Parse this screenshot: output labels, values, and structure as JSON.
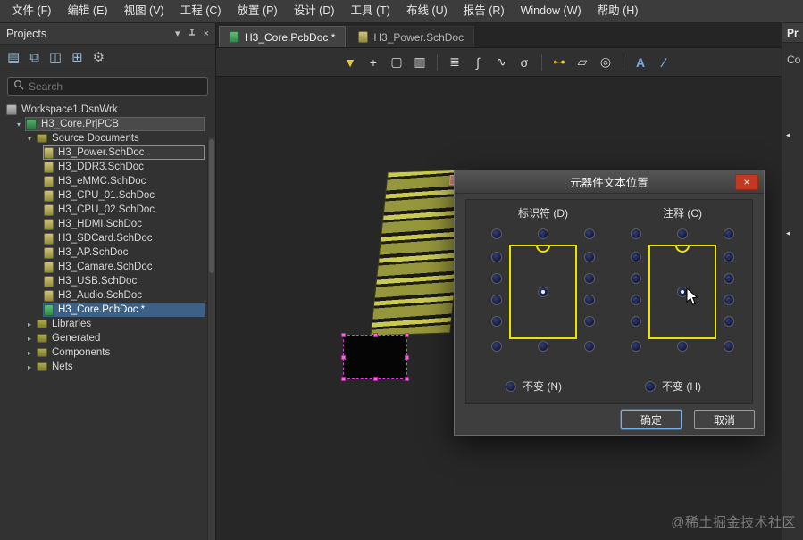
{
  "menu": {
    "items": [
      "文件 (F)",
      "编辑 (E)",
      "视图 (V)",
      "工程 (C)",
      "放置 (P)",
      "设计 (D)",
      "工具 (T)",
      "布线 (U)",
      "报告 (R)",
      "Window (W)",
      "帮助 (H)"
    ]
  },
  "glyphs": {
    "expanded": "▾",
    "collapsed": "▸",
    "dropdown": "▾",
    "close": "×"
  },
  "projects": {
    "title": "Projects",
    "search_placeholder": "Search",
    "toolbar": [
      {
        "name": "save-icon",
        "glyph": "▤"
      },
      {
        "name": "documents-icon",
        "glyph": "⧉"
      },
      {
        "name": "open-documents-icon",
        "glyph": "◫"
      },
      {
        "name": "compile-icon",
        "glyph": "⊞"
      },
      {
        "name": "settings-gear-icon",
        "glyph": "⚙"
      }
    ],
    "tree": [
      {
        "label": "Workspace1.DsnWrk"
      },
      {
        "label": "H3_Core.PrjPCB"
      },
      {
        "label": "Source Documents"
      },
      {
        "label": "H3_Power.SchDoc"
      },
      {
        "label": "H3_DDR3.SchDoc"
      },
      {
        "label": "H3_eMMC.SchDoc"
      },
      {
        "label": "H3_CPU_01.SchDoc"
      },
      {
        "label": "H3_CPU_02.SchDoc"
      },
      {
        "label": "H3_HDMI.SchDoc"
      },
      {
        "label": "H3_SDCard.SchDoc"
      },
      {
        "label": "H3_AP.SchDoc"
      },
      {
        "label": "H3_Camare.SchDoc"
      },
      {
        "label": "H3_USB.SchDoc"
      },
      {
        "label": "H3_Audio.SchDoc"
      },
      {
        "label": "H3_Core.PcbDoc *"
      },
      {
        "label": "Libraries"
      },
      {
        "label": "Generated"
      },
      {
        "label": "Components"
      },
      {
        "label": "Nets"
      }
    ]
  },
  "tabs": [
    {
      "label": "H3_Core.PcbDoc *"
    },
    {
      "label": "H3_Power.SchDoc"
    }
  ],
  "main_toolbar": {
    "icons": [
      {
        "name": "filter-icon",
        "glyph": "▼"
      },
      {
        "name": "crosshair-icon",
        "glyph": "+"
      },
      {
        "name": "selection-box-icon",
        "glyph": "▢"
      },
      {
        "name": "column-chart-icon",
        "glyph": "▥"
      },
      {
        "name": "layers-icon",
        "glyph": "≣"
      },
      {
        "name": "route-icon",
        "glyph": "∫"
      },
      {
        "name": "arc-route-icon",
        "glyph": "∿"
      },
      {
        "name": "sigma-icon",
        "glyph": "σ"
      },
      {
        "name": "key-icon",
        "glyph": "⊶"
      },
      {
        "name": "plane-icon",
        "glyph": "▱"
      },
      {
        "name": "via-icon",
        "glyph": "◎"
      },
      {
        "name": "text-icon",
        "glyph": "A"
      },
      {
        "name": "draw-line-icon",
        "glyph": "∕"
      }
    ]
  },
  "dialog": {
    "title": "元器件文本位置",
    "designator_label": "标识符 (D)",
    "comment_label": "注释 (C)",
    "unchanged_n": "不变 (N)",
    "unchanged_h": "不变 (H)",
    "ok": "确定",
    "cancel": "取消"
  },
  "right_panel": {
    "title": "Pr",
    "item": "Co"
  },
  "watermark": "@稀土掘金技术社区",
  "colors": {
    "selection_blue": "#3d6185",
    "chip_yellow": "#ece400",
    "close_red": "#c2391f",
    "component_magenta": "#d843d8",
    "pcb_yellow": "#caca52"
  }
}
